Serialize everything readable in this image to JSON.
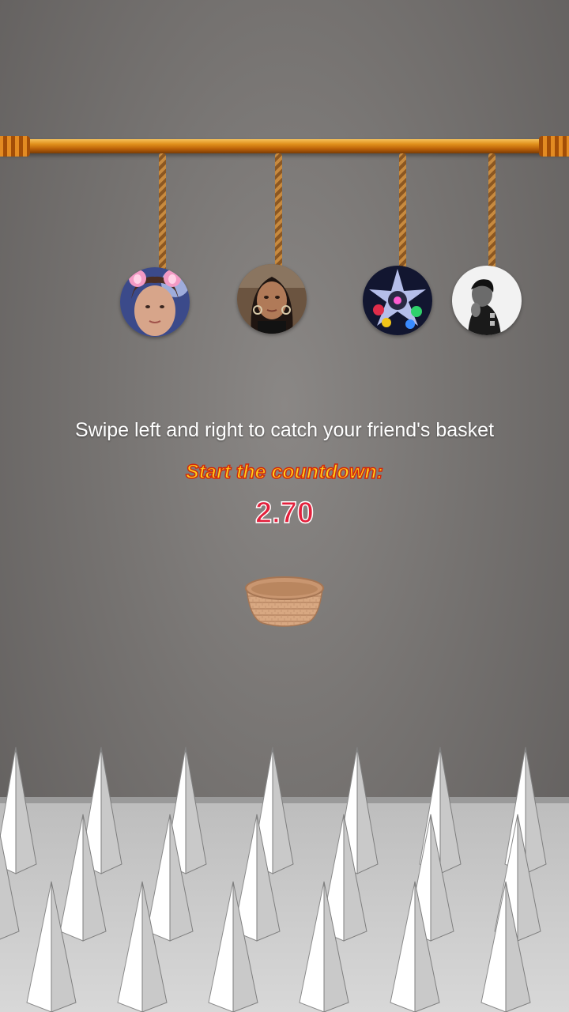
{
  "game": {
    "instruction": "Swipe left and right to catch your friend's basket",
    "countdown_label": "Start the countdown:",
    "countdown_value": "2.70"
  },
  "avatars": [
    {
      "name": "friend-1",
      "icon": "bunny-ears-filter-portrait"
    },
    {
      "name": "friend-2",
      "icon": "woman-portrait"
    },
    {
      "name": "friend-3",
      "icon": "colorful-character-portrait"
    },
    {
      "name": "friend-4",
      "icon": "black-and-white-portrait"
    }
  ],
  "colors": {
    "bar": "#e0901b",
    "countdown_label": "#ffd21a",
    "countdown_value": "#e3203c",
    "spikes": "#e6e6e6"
  }
}
